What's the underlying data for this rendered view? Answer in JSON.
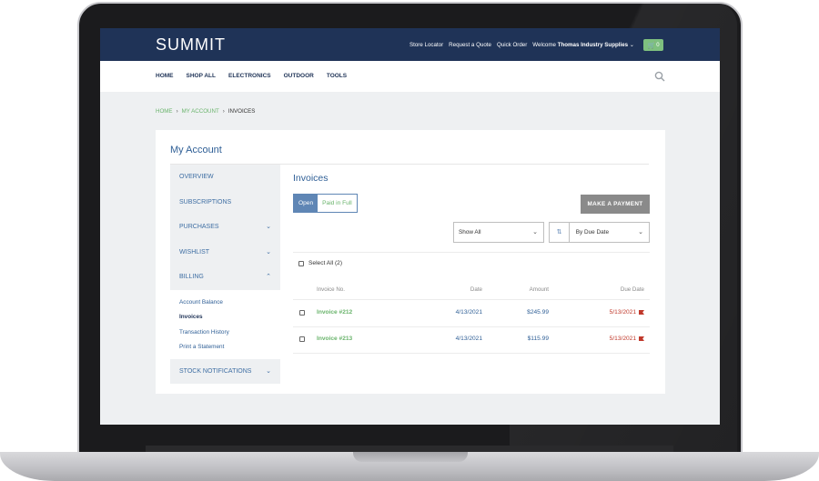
{
  "brand": "SUMMIT",
  "utility": {
    "links": [
      "Store Locator",
      "Request a Quote",
      "Quick Order"
    ],
    "welcome_prefix": "Welcome",
    "welcome_name": "Thomas Industry Supplies",
    "cart_count": "0"
  },
  "nav": [
    "HOME",
    "SHOP ALL",
    "ELECTRONICS",
    "OUTDOOR",
    "TOOLS"
  ],
  "breadcrumb": [
    "HOME",
    "MY ACCOUNT",
    "INVOICES"
  ],
  "account": {
    "title": "My Account",
    "sidebar": [
      {
        "label": "OVERVIEW",
        "chevron": ""
      },
      {
        "label": "SUBSCRIPTIONS",
        "chevron": ""
      },
      {
        "label": "PURCHASES",
        "chevron": "v"
      },
      {
        "label": "WISHLIST",
        "chevron": "v"
      },
      {
        "label": "BILLING",
        "chevron": "^"
      }
    ],
    "billing_sub": [
      "Account Balance",
      "Invoices",
      "Transaction History",
      "Print a Statement"
    ],
    "billing_active": "Invoices",
    "stock_notifications": "STOCK NOTIFICATIONS"
  },
  "invoices": {
    "title": "Invoices",
    "filter_open": "Open",
    "filter_paid": "Paid in Full",
    "make_payment": "MAKE A PAYMENT",
    "show_select": "Show All",
    "sort_select": "By Due Date",
    "select_all": "Select All (2)",
    "headers": {
      "invoice": "Invoice No.",
      "date": "Date",
      "amount": "Amount",
      "due": "Due Date"
    },
    "rows": [
      {
        "invoice": "Invoice #212",
        "date": "4/13/2021",
        "amount": "$245.99",
        "due": "5/13/2021"
      },
      {
        "invoice": "Invoice #213",
        "date": "4/13/2021",
        "amount": "$115.99",
        "due": "5/13/2021"
      }
    ]
  },
  "colors": {
    "header": "#1f3357",
    "accent": "#6ab46c",
    "link": "#2f5f96",
    "overdue": "#c0392b"
  }
}
